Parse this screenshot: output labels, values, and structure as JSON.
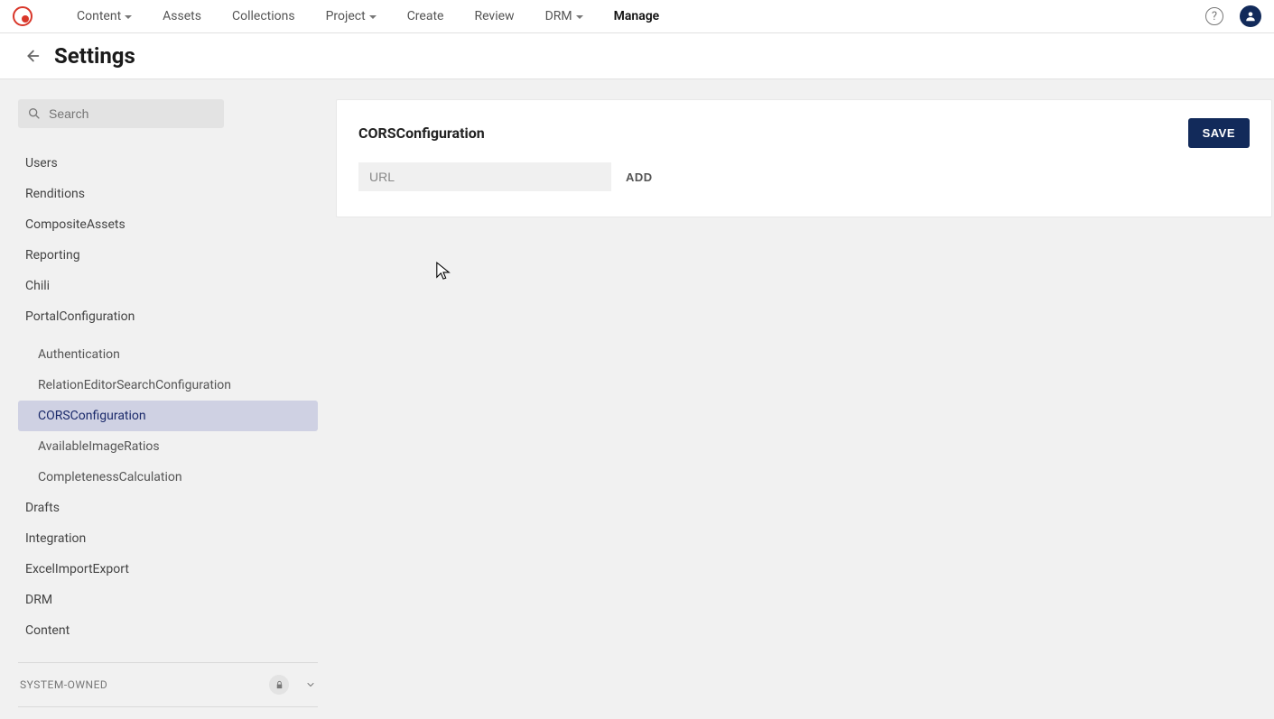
{
  "nav": {
    "items": [
      {
        "label": "Content",
        "dropdown": true
      },
      {
        "label": "Assets",
        "dropdown": false
      },
      {
        "label": "Collections",
        "dropdown": false
      },
      {
        "label": "Project",
        "dropdown": true
      },
      {
        "label": "Create",
        "dropdown": false
      },
      {
        "label": "Review",
        "dropdown": false
      },
      {
        "label": "DRM",
        "dropdown": true
      },
      {
        "label": "Manage",
        "dropdown": false,
        "active": true
      }
    ]
  },
  "page": {
    "title": "Settings"
  },
  "search": {
    "placeholder": "Search"
  },
  "sidebar": {
    "items": [
      {
        "label": "Users"
      },
      {
        "label": "Renditions"
      },
      {
        "label": "CompositeAssets"
      },
      {
        "label": "Reporting"
      },
      {
        "label": "Chili"
      },
      {
        "label": "PortalConfiguration",
        "children": [
          {
            "label": "Authentication"
          },
          {
            "label": "RelationEditorSearchConfiguration"
          },
          {
            "label": "CORSConfiguration",
            "selected": true
          },
          {
            "label": "AvailableImageRatios"
          },
          {
            "label": "CompletenessCalculation"
          }
        ]
      },
      {
        "label": "Drafts"
      },
      {
        "label": "Integration"
      },
      {
        "label": "ExcelImportExport"
      },
      {
        "label": "DRM"
      },
      {
        "label": "Content"
      }
    ],
    "section_label": "SYSTEM-OWNED"
  },
  "card": {
    "title": "CORSConfiguration",
    "save_label": "SAVE",
    "url_placeholder": "URL",
    "add_label": "ADD"
  }
}
